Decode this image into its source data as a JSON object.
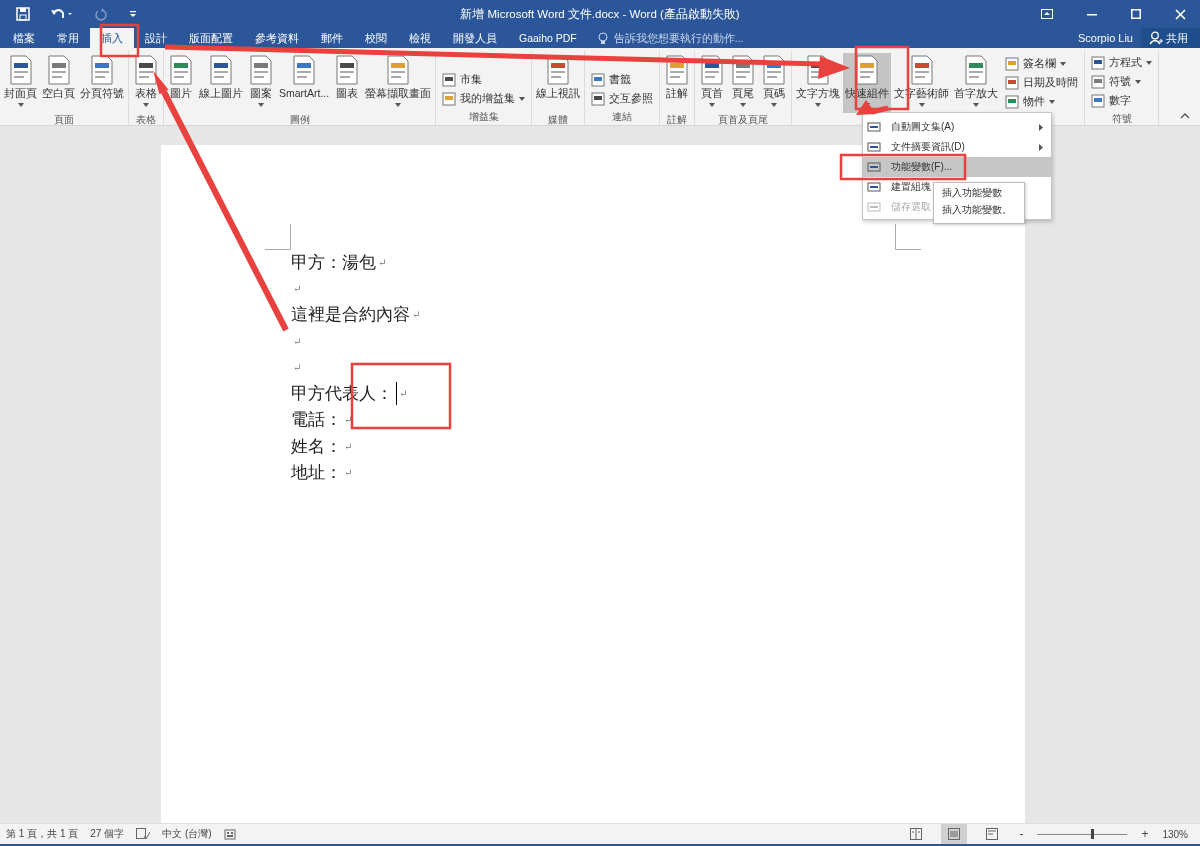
{
  "window": {
    "title": "新增 Microsoft Word 文件.docx - Word (產品啟動失敗)",
    "redo_disabled": true
  },
  "tabs": [
    {
      "label": "檔案",
      "selected": false
    },
    {
      "label": "常用",
      "selected": false
    },
    {
      "label": "插入",
      "selected": true
    },
    {
      "label": "設計",
      "selected": false
    },
    {
      "label": "版面配置",
      "selected": false
    },
    {
      "label": "參考資料",
      "selected": false
    },
    {
      "label": "郵件",
      "selected": false
    },
    {
      "label": "校閱",
      "selected": false
    },
    {
      "label": "檢視",
      "selected": false
    },
    {
      "label": "開發人員",
      "selected": false
    },
    {
      "label": "Gaaiho PDF",
      "selected": false
    }
  ],
  "tell_me": {
    "placeholder": "告訴我您想要執行的動作..."
  },
  "user": {
    "name": "Scorpio Liu",
    "share": "共用"
  },
  "ribbon_groups": [
    {
      "label": "頁面",
      "items": [
        {
          "kind": "large",
          "label": "封面頁",
          "dropdown": true,
          "selected": false
        },
        {
          "kind": "large",
          "label": "空白頁",
          "dropdown": false,
          "selected": false
        },
        {
          "kind": "large",
          "label": "分頁符號",
          "dropdown": false,
          "selected": false
        }
      ]
    },
    {
      "label": "表格",
      "items": [
        {
          "kind": "large",
          "label": "表格",
          "dropdown": true,
          "selected": false
        }
      ]
    },
    {
      "label": "圖例",
      "items": [
        {
          "kind": "large",
          "label": "圖片",
          "dropdown": false,
          "selected": false
        },
        {
          "kind": "large",
          "label": "線上圖片",
          "dropdown": false,
          "selected": false
        },
        {
          "kind": "large",
          "label": "圖案",
          "dropdown": true,
          "selected": false
        },
        {
          "kind": "large",
          "label": "SmartArt...",
          "dropdown": false,
          "selected": false
        },
        {
          "kind": "large",
          "label": "圖表",
          "dropdown": false,
          "selected": false
        },
        {
          "kind": "large",
          "label": "螢幕擷取畫面",
          "dropdown": true,
          "selected": false
        }
      ]
    },
    {
      "label": "增益集",
      "items": [
        {
          "kind": "stack",
          "items": [
            {
              "label": "市集",
              "dropdown": false
            },
            {
              "label": "我的增益集",
              "dropdown": true
            }
          ]
        }
      ]
    },
    {
      "label": "媒體",
      "items": [
        {
          "kind": "large",
          "label": "線上視訊",
          "dropdown": false,
          "selected": false
        }
      ]
    },
    {
      "label": "連結",
      "items": [
        {
          "kind": "stack",
          "items": [
            {
              "label": "書籤",
              "dropdown": false
            },
            {
              "label": "交互參照",
              "dropdown": false
            }
          ]
        }
      ]
    },
    {
      "label": "註解",
      "items": [
        {
          "kind": "large",
          "label": "註解",
          "dropdown": false,
          "selected": false
        }
      ]
    },
    {
      "label": "頁首及頁尾",
      "items": [
        {
          "kind": "large",
          "label": "頁首",
          "dropdown": true,
          "selected": false
        },
        {
          "kind": "large",
          "label": "頁尾",
          "dropdown": true,
          "selected": false
        },
        {
          "kind": "large",
          "label": "頁碼",
          "dropdown": true,
          "selected": false
        }
      ]
    },
    {
      "items": [
        {
          "kind": "large",
          "label": "文字方塊",
          "dropdown": true,
          "selected": false
        },
        {
          "kind": "large",
          "label": "快速組件",
          "dropdown": true,
          "selected": true
        },
        {
          "kind": "large",
          "label": "文字藝術師",
          "dropdown": true,
          "selected": false
        },
        {
          "kind": "large",
          "label": "首字放大",
          "dropdown": true,
          "selected": false
        },
        {
          "kind": "stack",
          "items": [
            {
              "label": "簽名欄",
              "dropdown": true
            },
            {
              "label": "日期及時間",
              "dropdown": false
            },
            {
              "label": "物件",
              "dropdown": true
            }
          ]
        }
      ]
    },
    {
      "label": "符號",
      "items": [
        {
          "kind": "stack",
          "items": [
            {
              "label": "方程式",
              "dropdown": true
            },
            {
              "label": "符號",
              "dropdown": true
            },
            {
              "label": "數字",
              "dropdown": false
            }
          ]
        }
      ]
    }
  ],
  "quick_parts_menu": [
    {
      "label": "自動圖文集(A)",
      "submenu": true,
      "selected": false,
      "disabled": false
    },
    {
      "label": "文件摘要資訊(D)",
      "submenu": true,
      "selected": false,
      "disabled": false
    },
    {
      "label": "功能變數(F)...",
      "submenu": false,
      "selected": true,
      "disabled": false
    },
    {
      "label": "建置組塊",
      "submenu": false,
      "selected": false,
      "disabled": false
    },
    {
      "label": "儲存選取",
      "submenu": false,
      "selected": false,
      "disabled": true
    }
  ],
  "tooltip": {
    "title": "插入功能變數",
    "description": "插入功能變數。"
  },
  "document": [
    {
      "text": "甲方：湯包",
      "mark": "↵",
      "cursor": false
    },
    {
      "mark": "↵",
      "cursor": false
    },
    {
      "text": "這裡是合約內容",
      "mark": "↵",
      "cursor": false
    },
    {
      "mark": "↵",
      "cursor": false
    },
    {
      "mark": "↵",
      "cursor": false
    },
    {
      "text": "甲方代表人：",
      "mark": "↵",
      "cursor": true
    },
    {
      "text": "電話：",
      "mark": "↵",
      "cursor": false
    },
    {
      "text": "姓名：",
      "mark": "↵",
      "cursor": false
    },
    {
      "text": "地址：",
      "mark": "↵",
      "cursor": false
    }
  ],
  "status_bar": {
    "page": "第 1 頁，共 1 頁",
    "words": "27 個字",
    "language": "中文 (台灣)",
    "views": [
      {
        "selected": false
      },
      {
        "selected": true
      },
      {
        "selected": false
      }
    ],
    "zoom_out": "-",
    "zoom_in": "+",
    "zoom": {
      "level": 0.6
    },
    "zoom_text": "130%"
  }
}
